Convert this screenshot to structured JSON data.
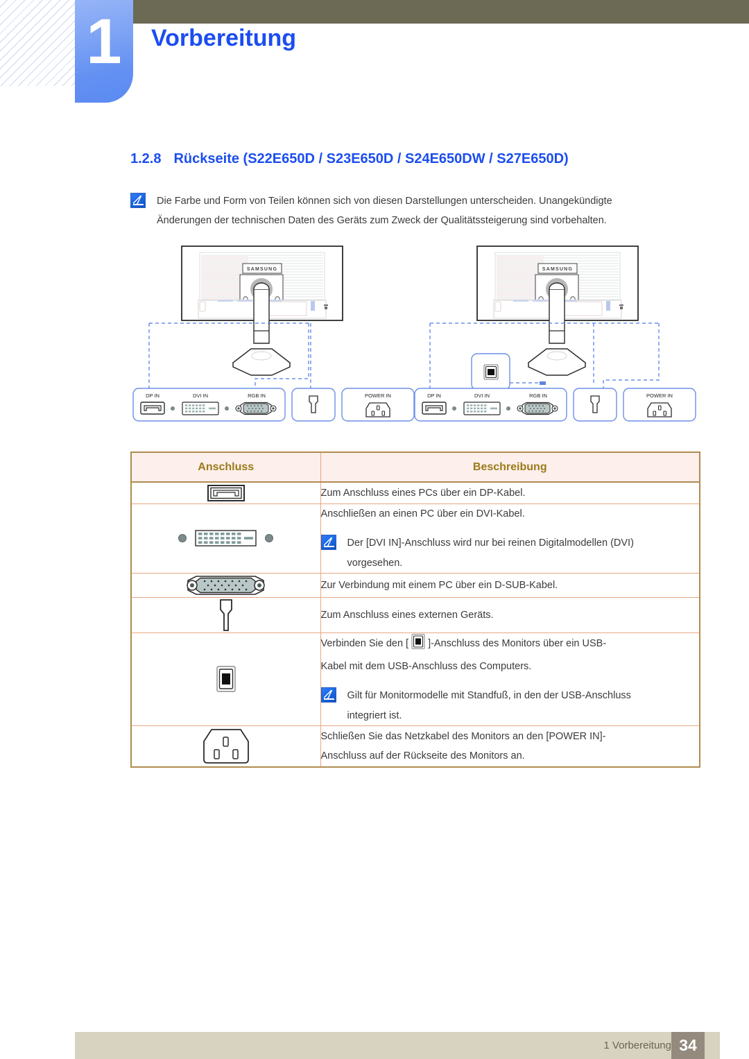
{
  "header": {
    "chapter_number": "1",
    "chapter_title": "Vorbereitung",
    "olive_color": "#6c6a54",
    "tab_color": "#6390f2",
    "title_color": "#1b4df0"
  },
  "section": {
    "number": "1.2.8",
    "title": "Rückseite (S22E650D / S23E650D / S24E650DW / S27E650D)",
    "color": "#1b4df0"
  },
  "top_note": {
    "icon": "note-pen-icon",
    "line1": "Die Farbe und Form von Teilen können sich von diesen Darstellungen unterscheiden. Unangekündigte",
    "line2": "Änderungen der technischen Daten des Geräts zum Zweck der Qualitätssteigerung sind vorbehalten."
  },
  "diagrams": {
    "left": {
      "name": "monitor-rear-view-left",
      "brand_label": "SAMSUNG",
      "port_group_labels": [
        "DP IN",
        "DVI IN",
        "RGB IN"
      ],
      "audio_group_label": "",
      "power_group_label": "POWER IN"
    },
    "right": {
      "name": "monitor-rear-view-right-with-usb",
      "brand_label": "SAMSUNG",
      "port_group_labels": [
        "DP IN",
        "DVI IN",
        "RGB IN"
      ],
      "usb_callout_label": "",
      "audio_group_label": "",
      "power_group_label": "POWER IN"
    }
  },
  "table": {
    "headers": [
      "Anschluss",
      "Beschreibung"
    ],
    "header_text_color": "#9c7a19",
    "header_bg": "#fcefec",
    "border_color": "#b08b4f",
    "rows": [
      {
        "icon": "displayport-connector-icon",
        "lines": [
          "Zum Anschluss eines PCs über ein DP-Kabel."
        ],
        "note": null
      },
      {
        "icon": "dvi-connector-icon",
        "lines": [
          "Anschließen an einen PC über ein DVI-Kabel."
        ],
        "note": {
          "icon": "note-pen-icon",
          "line1": "Der [DVI IN]-Anschluss wird nur bei reinen Digitalmodellen (DVI)",
          "line2": "vorgesehen."
        }
      },
      {
        "icon": "dsub-vga-connector-icon",
        "lines": [
          "Zur Verbindung mit einem PC über ein D-SUB-Kabel."
        ],
        "note": null
      },
      {
        "icon": "audio-headphone-jack-icon",
        "lines": [
          "Zum Anschluss eines externen Geräts."
        ],
        "note": null
      },
      {
        "icon": "usb-type-b-connector-icon",
        "lines_split": {
          "before": "Verbinden Sie den [",
          "inline_icon": "usb-type-b-connector-icon",
          "after": "]-Anschluss des Monitors über ein USB-"
        },
        "lines": [
          "Kabel mit dem USB-Anschluss des Computers."
        ],
        "note": {
          "icon": "note-pen-icon",
          "line1": "Gilt für Monitormodelle mit Standfuß, in den der USB-Anschluss",
          "line2": "integriert ist."
        }
      },
      {
        "icon": "power-inlet-connector-icon",
        "lines": [
          "Schließen Sie das Netzkabel des Monitors an den [POWER IN]-",
          "Anschluss auf der Rückseite des Monitors an."
        ],
        "note": null
      }
    ]
  },
  "footer": {
    "label": "1 Vorbereitung",
    "page_number": "34",
    "band_color": "#d8d2c0",
    "page_box_color": "#948a7d"
  }
}
